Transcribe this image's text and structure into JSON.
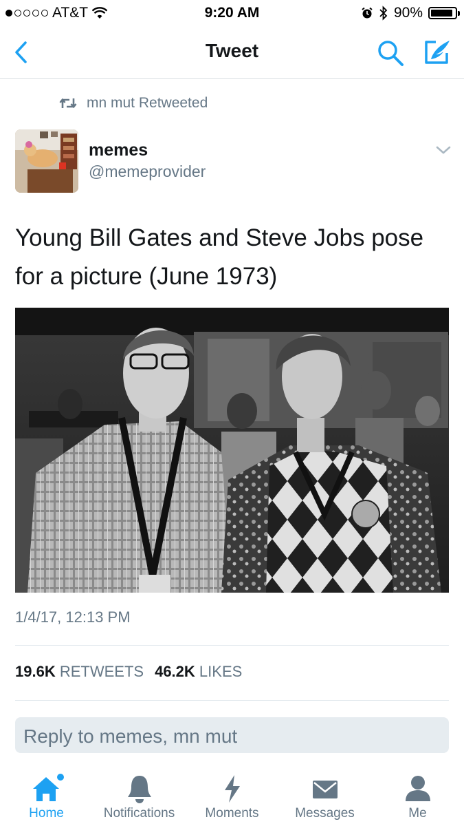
{
  "status_bar": {
    "carrier": "AT&T",
    "time": "9:20 AM",
    "battery_percent": "90%",
    "battery_level": 0.9
  },
  "nav": {
    "title": "Tweet"
  },
  "retweet_context": {
    "text": "mn mut Retweeted"
  },
  "author": {
    "name": "memes",
    "handle": "@memeprovider"
  },
  "tweet": {
    "text": "Young Bill Gates and Steve Jobs pose for a picture (June 1973)",
    "timestamp": "1/4/17, 12:13 PM"
  },
  "stats": {
    "retweets_count": "19.6K",
    "retweets_label": "RETWEETS",
    "likes_count": "46.2K",
    "likes_label": "LIKES"
  },
  "reply": {
    "placeholder": "Reply to memes, mn mut"
  },
  "tabs": [
    {
      "label": "Home",
      "icon": "home-icon",
      "active": true
    },
    {
      "label": "Notifications",
      "icon": "bell-icon",
      "active": false
    },
    {
      "label": "Moments",
      "icon": "lightning-icon",
      "active": false
    },
    {
      "label": "Messages",
      "icon": "envelope-icon",
      "active": false
    },
    {
      "label": "Me",
      "icon": "person-icon",
      "active": false
    }
  ],
  "colors": {
    "accent": "#1da1f2",
    "muted": "#657786",
    "text": "#14171a"
  }
}
